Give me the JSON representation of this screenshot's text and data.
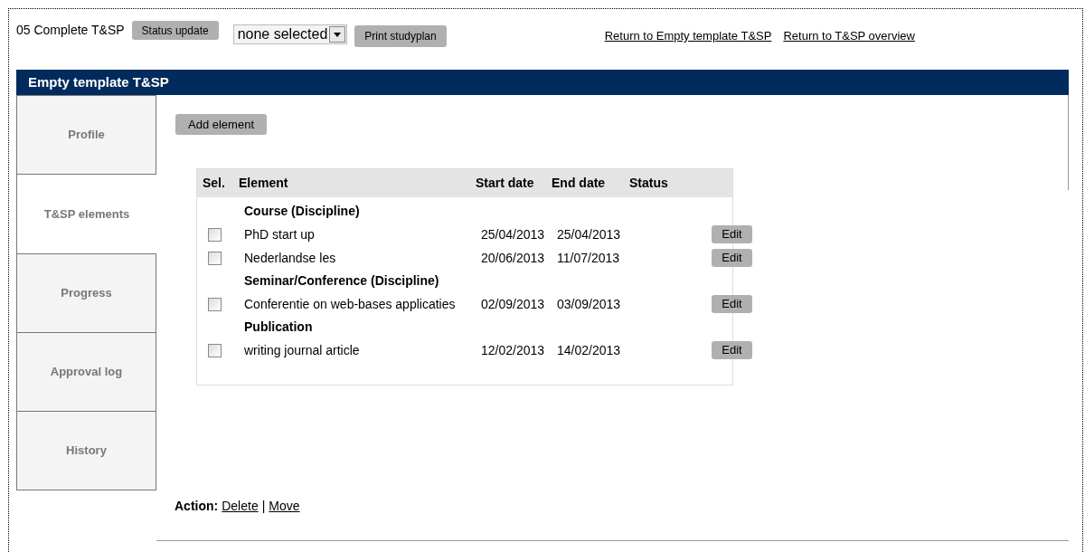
{
  "top_bar": {
    "status_label": "05 Complete T&SP",
    "status_button": "Status update",
    "select": {
      "value": "none selected"
    },
    "print_button": "Print studyplan",
    "links": [
      "Return to Empty template T&SP",
      "Return to T&SP overview"
    ]
  },
  "panel": {
    "title": "Empty template T&SP"
  },
  "tabs": [
    {
      "label": "Profile",
      "selected": false
    },
    {
      "label": "T&SP elements",
      "selected": true
    },
    {
      "label": "Progress",
      "selected": false
    },
    {
      "label": "Approval log",
      "selected": false
    },
    {
      "label": "History",
      "selected": false
    }
  ],
  "add_button": "Add element",
  "table": {
    "columns": [
      "Sel.",
      "Element",
      "Start date",
      "End date",
      "Status"
    ],
    "rows": [
      {
        "kind": "group",
        "label": "Course (Discipline)"
      },
      {
        "kind": "item",
        "checked": false,
        "element": "PhD start up",
        "start": "25/04/2013",
        "end": "25/04/2013",
        "button": "Edit"
      },
      {
        "kind": "item",
        "checked": false,
        "element": "Nederlandse les",
        "start": "20/06/2013",
        "end": "11/07/2013",
        "button": "Edit"
      },
      {
        "kind": "group",
        "label": "Seminar/Conference (Discipline)"
      },
      {
        "kind": "item",
        "checked": false,
        "element": "Conferentie on web-bases applicaties",
        "start": "02/09/2013",
        "end": "03/09/2013",
        "button": "Edit"
      },
      {
        "kind": "group",
        "label": "Publication"
      },
      {
        "kind": "item",
        "checked": false,
        "element": "writing journal article",
        "start": "12/02/2013",
        "end": "14/02/2013",
        "button": "Edit"
      }
    ]
  },
  "actions": {
    "label": "Action:",
    "links": [
      "Delete",
      "Move"
    ],
    "separator": "|"
  }
}
